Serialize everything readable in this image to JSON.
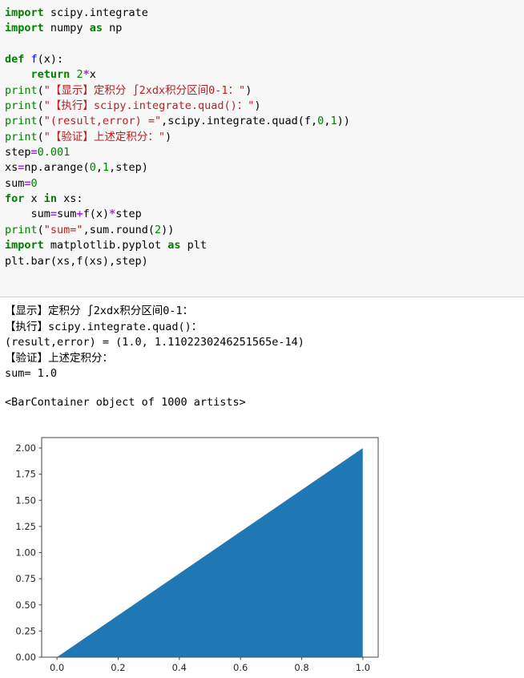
{
  "notebook": {
    "code_cell": {
      "lines": [
        [
          {
            "t": "import",
            "c": "kw"
          },
          {
            "t": " scipy",
            "c": "plain"
          },
          {
            "t": ".",
            "c": "plain"
          },
          {
            "t": "integrate",
            "c": "plain"
          }
        ],
        [
          {
            "t": "import",
            "c": "kw"
          },
          {
            "t": " numpy ",
            "c": "plain"
          },
          {
            "t": "as",
            "c": "kw"
          },
          {
            "t": " np",
            "c": "plain"
          }
        ],
        [],
        [
          {
            "t": "def",
            "c": "kw"
          },
          {
            "t": " ",
            "c": "plain"
          },
          {
            "t": "f",
            "c": "fn"
          },
          {
            "t": "(x):",
            "c": "plain"
          }
        ],
        [
          {
            "t": "    ",
            "c": "plain"
          },
          {
            "t": "return",
            "c": "kw"
          },
          {
            "t": " ",
            "c": "plain"
          },
          {
            "t": "2",
            "c": "num"
          },
          {
            "t": "*",
            "c": "op"
          },
          {
            "t": "x",
            "c": "plain"
          }
        ],
        [
          {
            "t": "print",
            "c": "bi"
          },
          {
            "t": "(",
            "c": "plain"
          },
          {
            "t": "\"【显示】定积分 ∫2xdx积分区间0-1：\"",
            "c": "str"
          },
          {
            "t": ")",
            "c": "plain"
          }
        ],
        [
          {
            "t": "print",
            "c": "bi"
          },
          {
            "t": "(",
            "c": "plain"
          },
          {
            "t": "\"【执行】scipy.integrate.quad()：\"",
            "c": "str"
          },
          {
            "t": ")",
            "c": "plain"
          }
        ],
        [
          {
            "t": "print",
            "c": "bi"
          },
          {
            "t": "(",
            "c": "plain"
          },
          {
            "t": "\"(result,error) =\"",
            "c": "str"
          },
          {
            "t": ",scipy.integrate.quad(f,",
            "c": "plain"
          },
          {
            "t": "0",
            "c": "num"
          },
          {
            "t": ",",
            "c": "plain"
          },
          {
            "t": "1",
            "c": "num"
          },
          {
            "t": "))",
            "c": "plain"
          }
        ],
        [
          {
            "t": "print",
            "c": "bi"
          },
          {
            "t": "(",
            "c": "plain"
          },
          {
            "t": "\"【验证】上述定积分：\"",
            "c": "str"
          },
          {
            "t": ")",
            "c": "plain"
          }
        ],
        [
          {
            "t": "step",
            "c": "plain"
          },
          {
            "t": "=",
            "c": "op"
          },
          {
            "t": "0.001",
            "c": "num"
          }
        ],
        [
          {
            "t": "xs",
            "c": "plain"
          },
          {
            "t": "=",
            "c": "op"
          },
          {
            "t": "np.arange(",
            "c": "plain"
          },
          {
            "t": "0",
            "c": "num"
          },
          {
            "t": ",",
            "c": "plain"
          },
          {
            "t": "1",
            "c": "num"
          },
          {
            "t": ",step)",
            "c": "plain"
          }
        ],
        [
          {
            "t": "sum",
            "c": "plain"
          },
          {
            "t": "=",
            "c": "op"
          },
          {
            "t": "0",
            "c": "num"
          }
        ],
        [
          {
            "t": "for",
            "c": "kw"
          },
          {
            "t": " x ",
            "c": "plain"
          },
          {
            "t": "in",
            "c": "kw"
          },
          {
            "t": " xs:",
            "c": "plain"
          }
        ],
        [
          {
            "t": "    sum",
            "c": "plain"
          },
          {
            "t": "=",
            "c": "op"
          },
          {
            "t": "sum",
            "c": "plain"
          },
          {
            "t": "+",
            "c": "op"
          },
          {
            "t": "f(x)",
            "c": "plain"
          },
          {
            "t": "*",
            "c": "op"
          },
          {
            "t": "step",
            "c": "plain"
          }
        ],
        [
          {
            "t": "print",
            "c": "bi"
          },
          {
            "t": "(",
            "c": "plain"
          },
          {
            "t": "\"sum=\"",
            "c": "str"
          },
          {
            "t": ",sum.round(",
            "c": "plain"
          },
          {
            "t": "2",
            "c": "num"
          },
          {
            "t": "))",
            "c": "plain"
          }
        ],
        [
          {
            "t": "import",
            "c": "kw"
          },
          {
            "t": " matplotlib.pyplot ",
            "c": "plain"
          },
          {
            "t": "as",
            "c": "kw"
          },
          {
            "t": " plt",
            "c": "plain"
          }
        ],
        [
          {
            "t": "plt.bar(xs,f(xs),step)",
            "c": "plain"
          }
        ]
      ]
    },
    "output": {
      "stdout_lines": [
        "【显示】定积分 ∫2xdx积分区间0-1：",
        "【执行】scipy.integrate.quad()：",
        "(result,error) = (1.0, 1.1102230246251565e-14)",
        "【验证】上述定积分：",
        "sum= 1.0"
      ],
      "repr_line": "<BarContainer object of 1000 artists>"
    }
  },
  "chart_data": {
    "type": "bar",
    "title": "",
    "xlabel": "",
    "ylabel": "",
    "xlim": [
      -0.05,
      1.05
    ],
    "ylim": [
      0.0,
      2.1
    ],
    "xticks": [
      "0.0",
      "0.2",
      "0.4",
      "0.6",
      "0.8",
      "1.0"
    ],
    "xtick_values": [
      0.0,
      0.2,
      0.4,
      0.6,
      0.8,
      1.0
    ],
    "yticks": [
      "0.00",
      "0.25",
      "0.50",
      "0.75",
      "1.00",
      "1.25",
      "1.50",
      "1.75",
      "2.00"
    ],
    "ytick_values": [
      0.0,
      0.25,
      0.5,
      0.75,
      1.0,
      1.25,
      1.5,
      1.75,
      2.0
    ],
    "grid": false,
    "legend": null,
    "bar_color": "#1f77b4",
    "n_bars": 1000,
    "bar_width": 0.001,
    "description": "y = 2x sampled at x = 0, 0.001, ... 0.999",
    "x": [
      0.0,
      0.1,
      0.2,
      0.3,
      0.4,
      0.5,
      0.6,
      0.7,
      0.8,
      0.9,
      0.999
    ],
    "values": [
      0.0,
      0.2,
      0.4,
      0.6,
      0.8,
      1.0,
      1.2,
      1.4,
      1.6,
      1.8,
      1.998
    ]
  },
  "colors": {
    "accent": "#1f77b4",
    "code_bg": "#f7f7f7",
    "keyword": "#008000",
    "string": "#ba2121",
    "operator": "#aa22ff",
    "function": "#0000ff"
  }
}
